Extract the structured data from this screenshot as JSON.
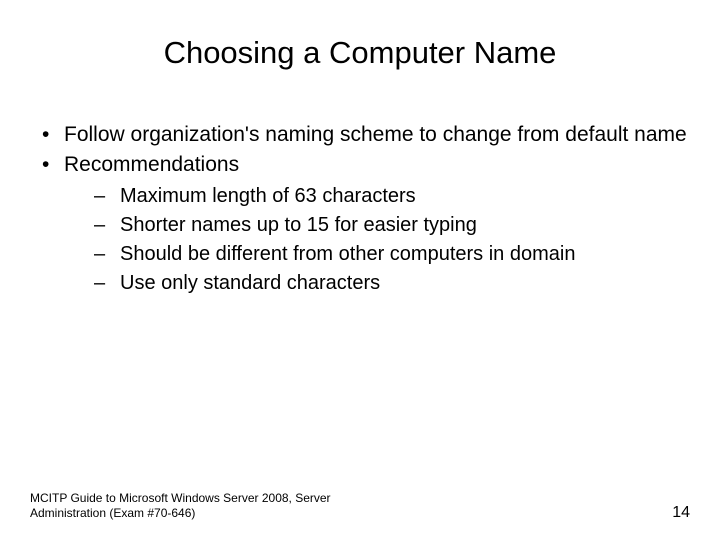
{
  "title": "Choosing a Computer Name",
  "bullets": [
    "Follow organization's naming scheme to change from default name",
    "Recommendations"
  ],
  "subBullets": [
    "Maximum length of 63 characters",
    "Shorter names up to 15 for easier typing",
    "Should be different from other computers in domain",
    "Use only standard characters"
  ],
  "footer": {
    "left": "MCITP Guide to Microsoft Windows Server 2008, Server Administration (Exam #70-646)",
    "pageNumber": "14"
  }
}
